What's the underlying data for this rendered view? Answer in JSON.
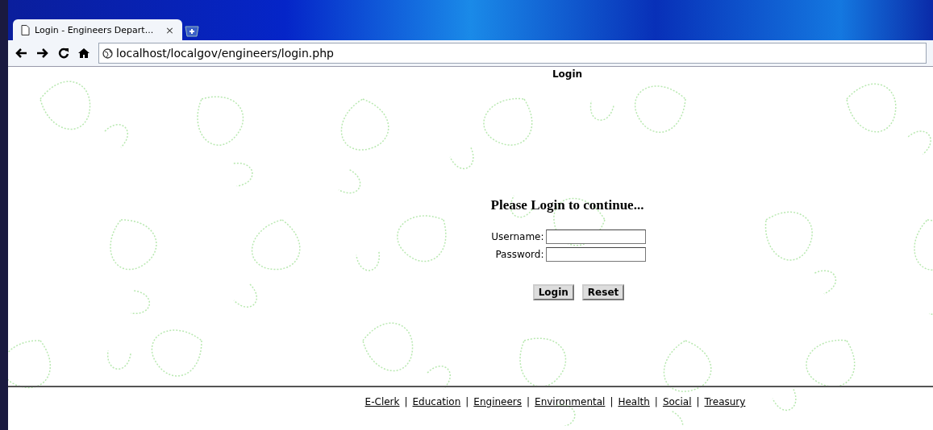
{
  "browser": {
    "tabs": [
      {
        "title": "Login - Engineers Depart...",
        "close": "×",
        "selected": true
      }
    ],
    "address": "localhost/localgov/engineers/login.php"
  },
  "page": {
    "title": "Login",
    "heading": "Please Login to continue...",
    "fields": [
      {
        "label": "Username:"
      },
      {
        "label": "Password:"
      }
    ],
    "buttons": [
      "Login",
      "Reset"
    ],
    "footer": [
      {
        "kind": "link",
        "text": "E-Clerk"
      },
      {
        "kind": "separator",
        "text": "|"
      },
      {
        "kind": "link",
        "text": "Education"
      },
      {
        "kind": "separator",
        "text": "|"
      },
      {
        "kind": "link",
        "text": "Engineers"
      },
      {
        "kind": "separator",
        "text": "|"
      },
      {
        "kind": "link",
        "text": "Environmental"
      },
      {
        "kind": "separator",
        "text": "|"
      },
      {
        "kind": "link",
        "text": "Health"
      },
      {
        "kind": "separator",
        "text": "|"
      },
      {
        "kind": "link",
        "text": "Social"
      },
      {
        "kind": "separator",
        "text": "|"
      },
      {
        "kind": "link",
        "text": "Treasury"
      }
    ]
  }
}
